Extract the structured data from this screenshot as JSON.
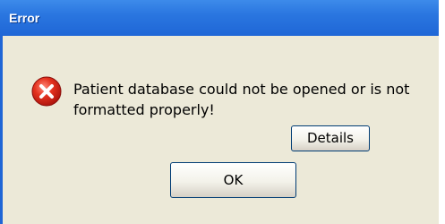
{
  "window": {
    "title": "Error"
  },
  "dialog": {
    "icon": "error-icon",
    "message": "Patient database could not be opened or is not formatted properly!",
    "details_label": "Details",
    "ok_label": "OK"
  },
  "colors": {
    "titlebar": "#1f66d6",
    "client_background": "#ece9d8",
    "error_icon": "#d9231e",
    "button_border": "#003c74"
  }
}
